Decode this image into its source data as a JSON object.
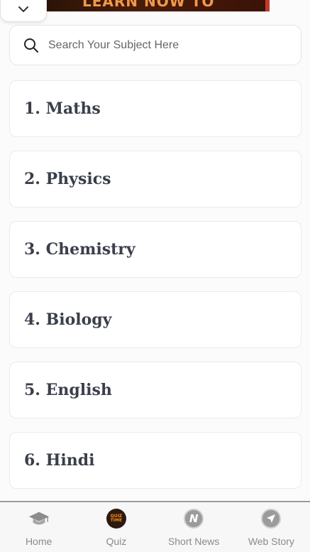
{
  "banner": {
    "text": "LEARN NOW TO"
  },
  "search": {
    "placeholder": "Search Your Subject Here",
    "value": ""
  },
  "subjects": [
    {
      "label": "1. Maths"
    },
    {
      "label": "2. Physics"
    },
    {
      "label": "3. Chemistry"
    },
    {
      "label": "4. Biology"
    },
    {
      "label": "5. English"
    },
    {
      "label": "6. Hindi"
    }
  ],
  "bottom_nav": {
    "items": [
      {
        "label": "Home",
        "icon": "graduation-cap-icon"
      },
      {
        "label": "Quiz",
        "icon": "quiz-time-icon",
        "badge_text": "QUIZ TIME"
      },
      {
        "label": "Short News",
        "icon": "news-n-icon",
        "glyph": "N"
      },
      {
        "label": "Web Story",
        "icon": "paper-plane-icon"
      }
    ]
  },
  "colors": {
    "background": "#fbfbfb",
    "card": "#ffffff",
    "card_text": "#3a3f4a",
    "nav_label": "#8a8a8a",
    "banner_bg": "#2a1408",
    "banner_text": "#f2994a"
  }
}
